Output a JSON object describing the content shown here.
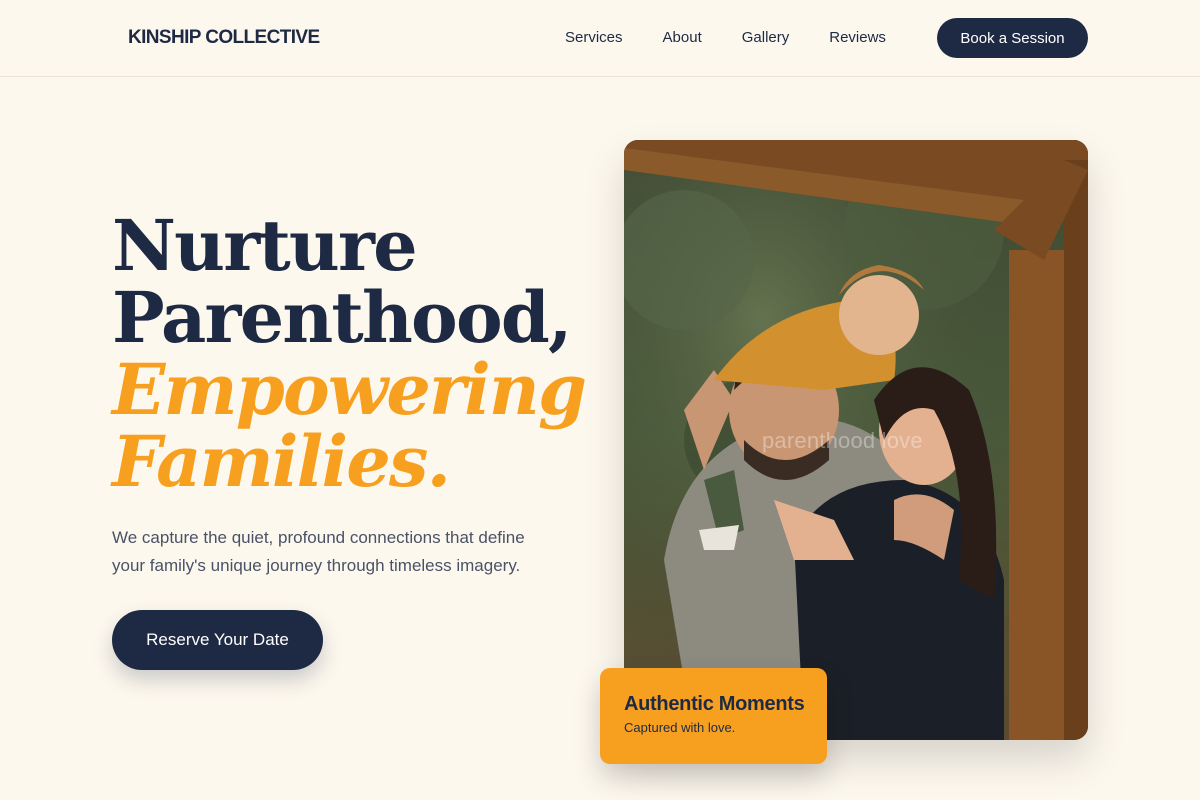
{
  "header": {
    "brand": "KINSHIP COLLECTIVE",
    "nav": [
      "Services",
      "About",
      "Gallery",
      "Reviews"
    ],
    "cta": "Book a Session"
  },
  "hero": {
    "title_line1": "Nurture",
    "title_line2": "Parenthood,",
    "title_accent1": "Empowering",
    "title_accent2": "Families.",
    "subtitle": "We capture the quiet, profound connections that define your family's unique journey through timeless imagery.",
    "cta": "Reserve Your Date"
  },
  "photo": {
    "watermark": "parenthood love"
  },
  "badge": {
    "title": "Authentic Moments",
    "subtitle": "Captured with love."
  },
  "colors": {
    "background": "#fdf8ee",
    "navy": "#1e2a44",
    "accent": "#f7a020"
  }
}
